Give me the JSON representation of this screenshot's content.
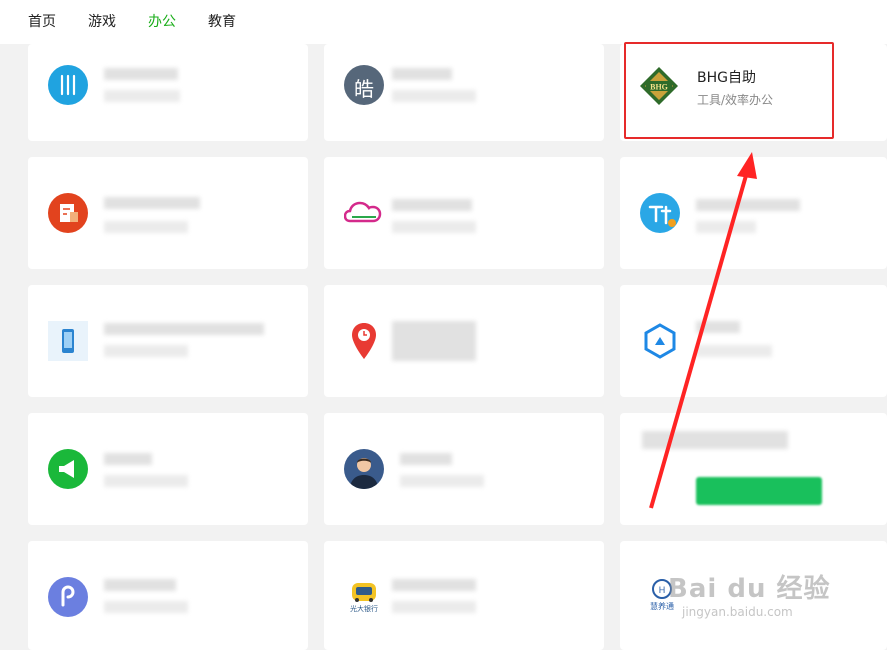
{
  "nav": {
    "tabs": [
      "首页",
      "游戏",
      "办公",
      "教育"
    ],
    "active_index": 2,
    "active_color": "#1aad19"
  },
  "highlight_app": {
    "name": "BHG自助",
    "category": "工具/效率办公",
    "logo_text": "BHG"
  },
  "icon_glyphs": {
    "hao_char": "皓",
    "guangda_logo_text": "光大银行",
    "huiyangtong_label": "慧养通"
  },
  "watermark": {
    "main": "Bai du 经验",
    "url": "jingyan.baidu.com"
  },
  "colors": {
    "red_frame": "#e62a2a",
    "arrow": "#ff2424"
  }
}
